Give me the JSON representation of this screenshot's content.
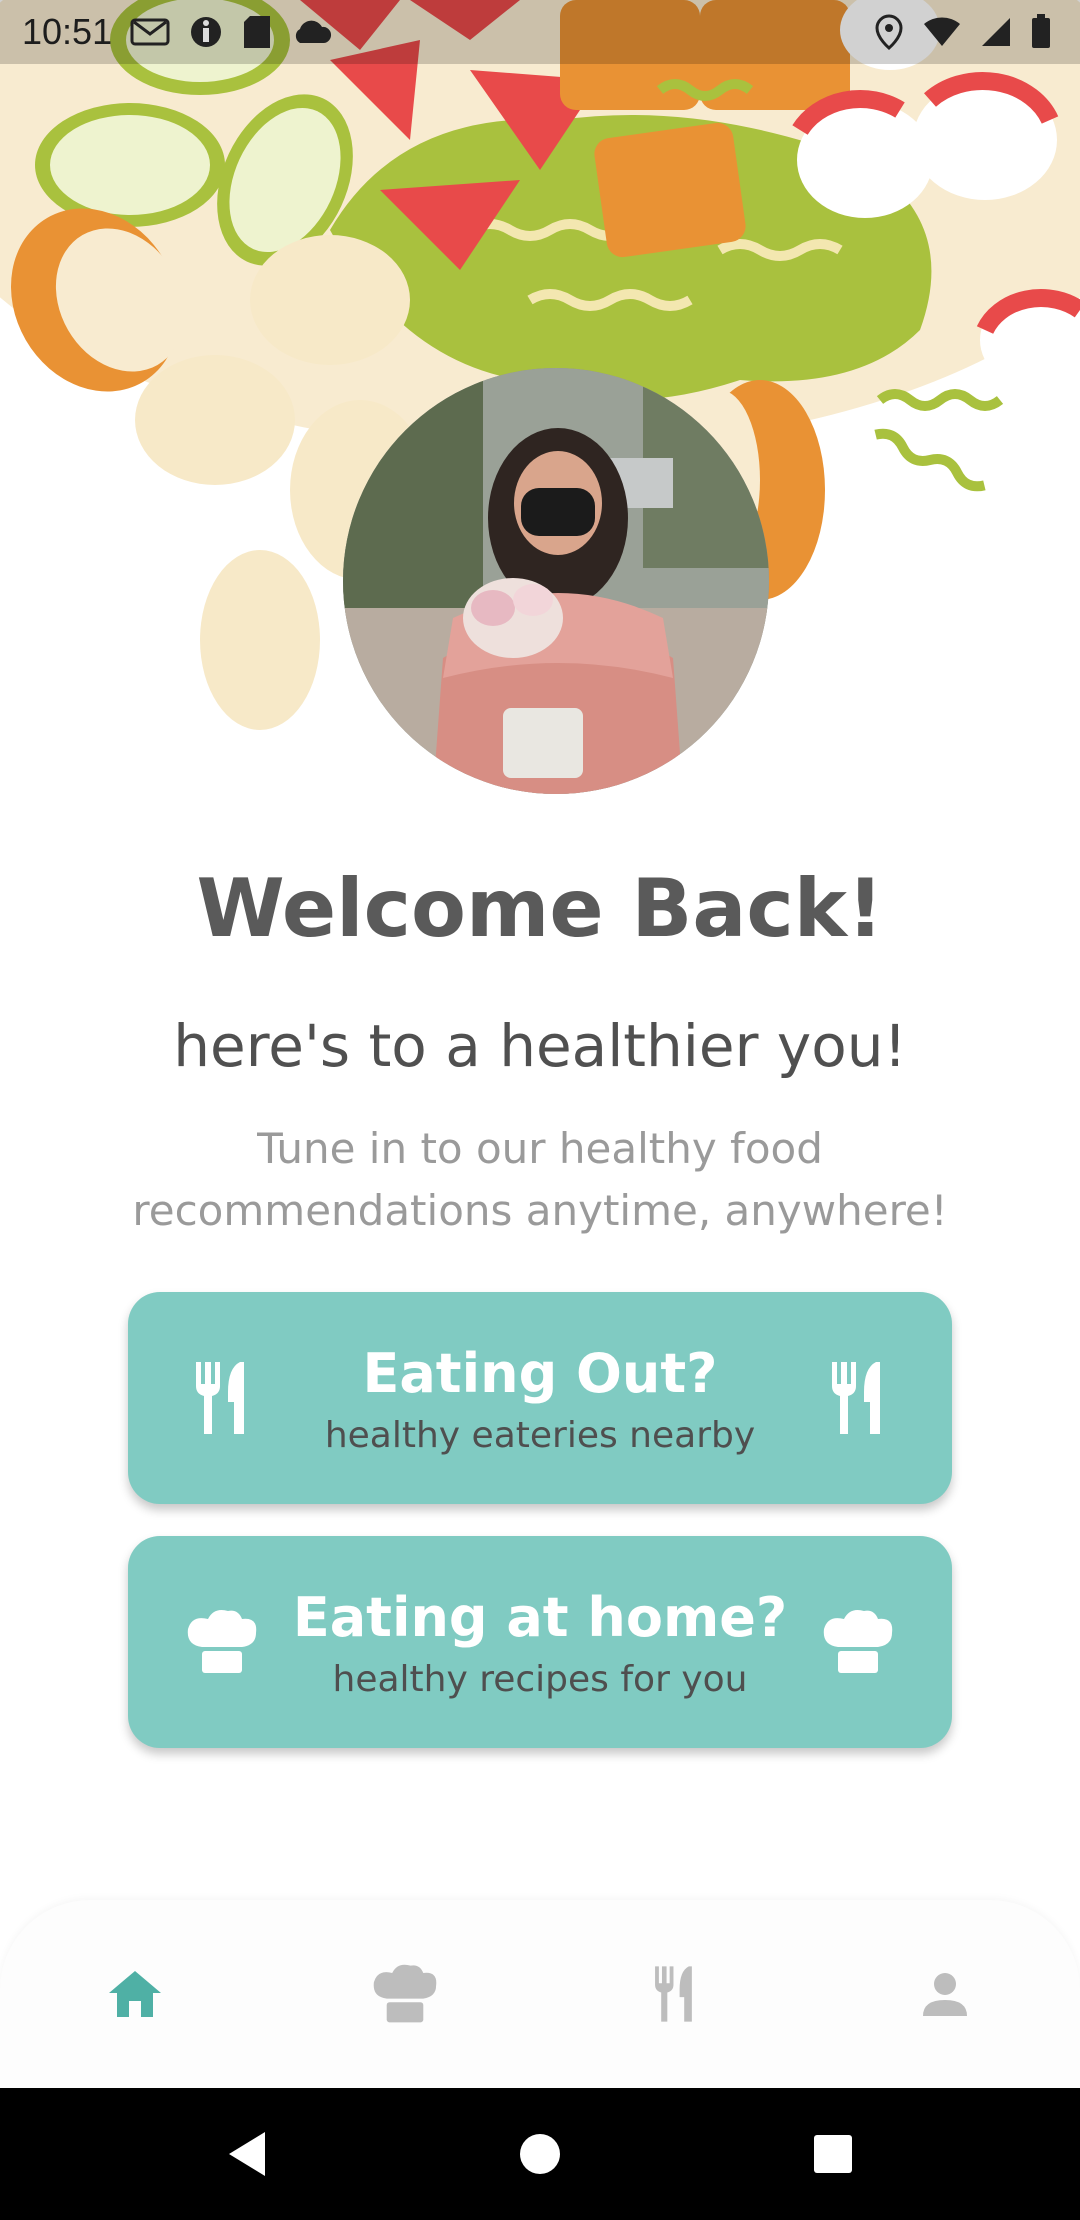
{
  "status_bar": {
    "time": "10:51"
  },
  "welcome": {
    "title": "Welcome Back!",
    "subtitle": "here's to a healthier you!",
    "description": "Tune in to our healthy food recommendations anytime, anywhere!"
  },
  "actions": [
    {
      "title": "Eating Out?",
      "subtitle": "healthy eateries nearby",
      "icon": "fork-knife-icon"
    },
    {
      "title": "Eating at home?",
      "subtitle": "healthy recipes for you",
      "icon": "chef-hat-icon"
    }
  ],
  "bottom_nav": {
    "items": [
      {
        "id": "home",
        "icon": "home-icon",
        "active": true
      },
      {
        "id": "recipes",
        "icon": "chef-hat-icon",
        "active": false
      },
      {
        "id": "eateries",
        "icon": "fork-knife-icon",
        "active": false
      },
      {
        "id": "profile",
        "icon": "person-icon",
        "active": false
      }
    ]
  },
  "colors": {
    "accent": "#80cbc2",
    "nav_active": "#4fb0a5",
    "nav_inactive": "#bdbdbd",
    "title": "#5a5a5a",
    "muted": "#9a9a9a"
  }
}
